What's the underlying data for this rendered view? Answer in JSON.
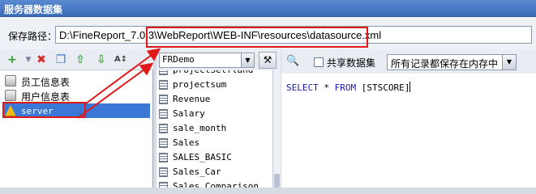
{
  "window": {
    "title": "服务器数据集"
  },
  "path_row": {
    "label": "保存路径：",
    "value": "D:\\FineReport_7.0.3\\WebReport\\WEB-INF\\resources\\datasource.xml"
  },
  "left_toolbar": {
    "icons": [
      "add-icon",
      "delete-icon",
      "copy-icon",
      "move-up-icon",
      "move-down-icon",
      "sort-icon"
    ],
    "add_symbol": "+",
    "delete_symbol": "✖",
    "copy_symbol": "❐",
    "up_symbol": "⇧",
    "down_symbol": "⇩",
    "sort_symbol": "A↕"
  },
  "dataset_tree": [
    {
      "label": "员工信息表",
      "icon": "database-icon"
    },
    {
      "label": "用户信息表",
      "icon": "database-icon"
    },
    {
      "label": "server",
      "icon": "warning-icon",
      "selected": true
    }
  ],
  "table_panel": {
    "connection": "FRDemo",
    "tool_symbol": "⚒",
    "tables": [
      "projectSelfland",
      "projectsum",
      "Revenue",
      "Salary",
      "sale_month",
      "Sales",
      "SALES_BASIC",
      "Sales_Car",
      "Sales_Comparison"
    ]
  },
  "query_panel": {
    "preview_symbol": "🔍",
    "share_label": "共享数据集",
    "share_checked": false,
    "save_mode": "所有记录都保存在内存中",
    "sql": {
      "select": "SELECT",
      "star": " * ",
      "from": "FROM",
      "table": " [STSCORE]"
    }
  },
  "colors": {
    "title_bar": "#3a6bb8",
    "highlight": "#e01818",
    "selection": "#3b78d6",
    "sql_keyword": "#1a1aa6"
  }
}
